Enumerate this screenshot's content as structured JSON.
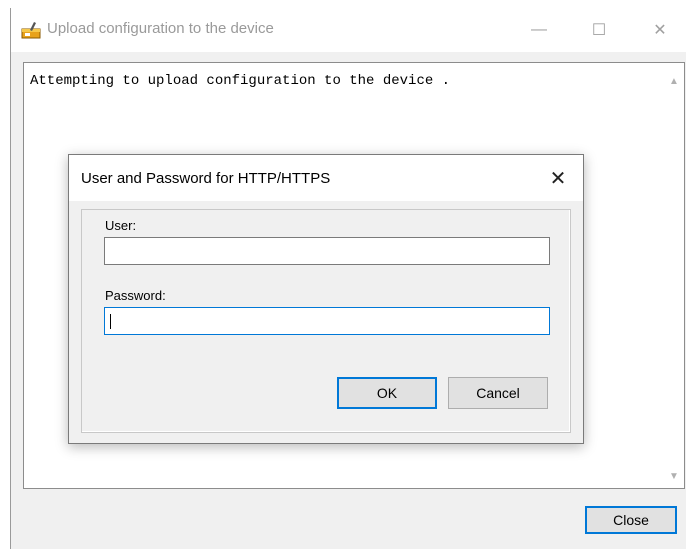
{
  "window": {
    "title": "Upload configuration to the device",
    "minimize_icon": "—",
    "maximize_icon": "☐",
    "close_icon": "✕"
  },
  "log": {
    "text": "Attempting to upload configuration to the device ."
  },
  "footer": {
    "close_label": "Close"
  },
  "dialog": {
    "title": "User and Password for HTTP/HTTPS",
    "close_icon": "✕",
    "user_label": "User:",
    "user_value": "",
    "password_label": "Password:",
    "password_value": "",
    "ok_label": "OK",
    "cancel_label": "Cancel"
  },
  "colors": {
    "accent": "#0078d7",
    "window_bg": "#f0f0f0"
  }
}
